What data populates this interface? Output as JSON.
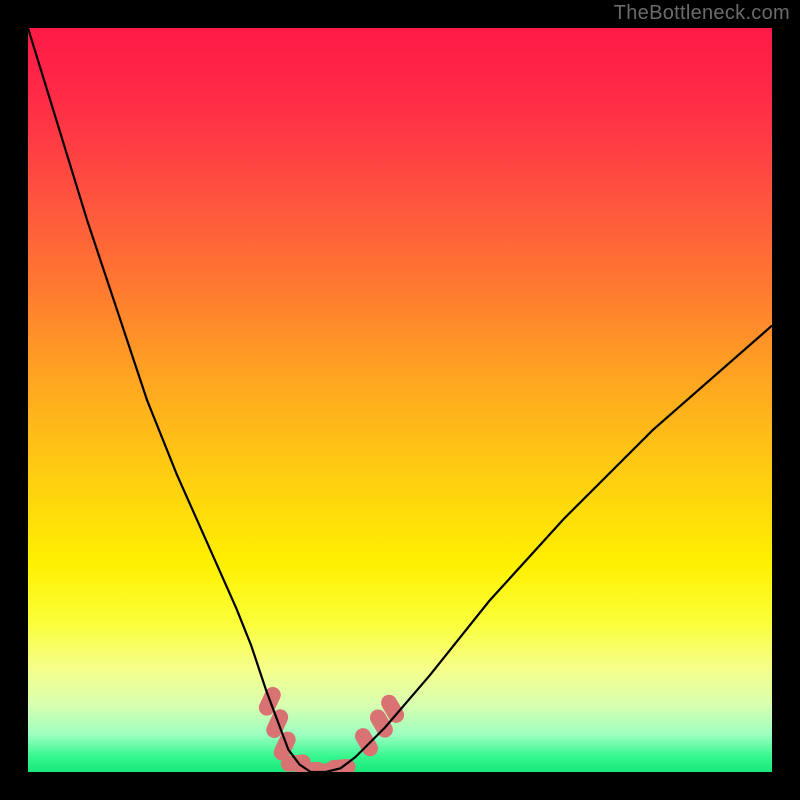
{
  "watermark": "TheBottleneck.com",
  "chart_data": {
    "type": "line",
    "title": "",
    "xlabel": "",
    "ylabel": "",
    "xlim": [
      0,
      100
    ],
    "ylim": [
      0,
      100
    ],
    "annotations": [],
    "series": [
      {
        "name": "bottleneck-curve",
        "x": [
          0,
          4,
          8,
          12,
          16,
          20,
          24,
          28,
          30,
          32,
          33.5,
          35,
          36.5,
          38,
          40,
          42,
          44,
          48,
          54,
          62,
          72,
          84,
          100
        ],
        "values": [
          100,
          87,
          74,
          62,
          50,
          40,
          31,
          22,
          17,
          11,
          7,
          3,
          1,
          0,
          0,
          0.5,
          2,
          6,
          13,
          23,
          34,
          46,
          60
        ]
      }
    ],
    "markers": {
      "name": "highlight-segments",
      "color": "#d97272",
      "points": [
        {
          "x": 32.5,
          "y": 9.5
        },
        {
          "x": 33.5,
          "y": 6.5
        },
        {
          "x": 34.5,
          "y": 3.5
        },
        {
          "x": 36.0,
          "y": 1.2
        },
        {
          "x": 38.0,
          "y": 0.2
        },
        {
          "x": 40.0,
          "y": 0.1
        },
        {
          "x": 42.0,
          "y": 0.6
        },
        {
          "x": 45.5,
          "y": 4.0
        },
        {
          "x": 47.5,
          "y": 6.5
        },
        {
          "x": 49.0,
          "y": 8.5
        }
      ]
    },
    "background_gradient": {
      "top": "#ff1a46",
      "mid": "#fff000",
      "bottom": "#17e878"
    }
  }
}
